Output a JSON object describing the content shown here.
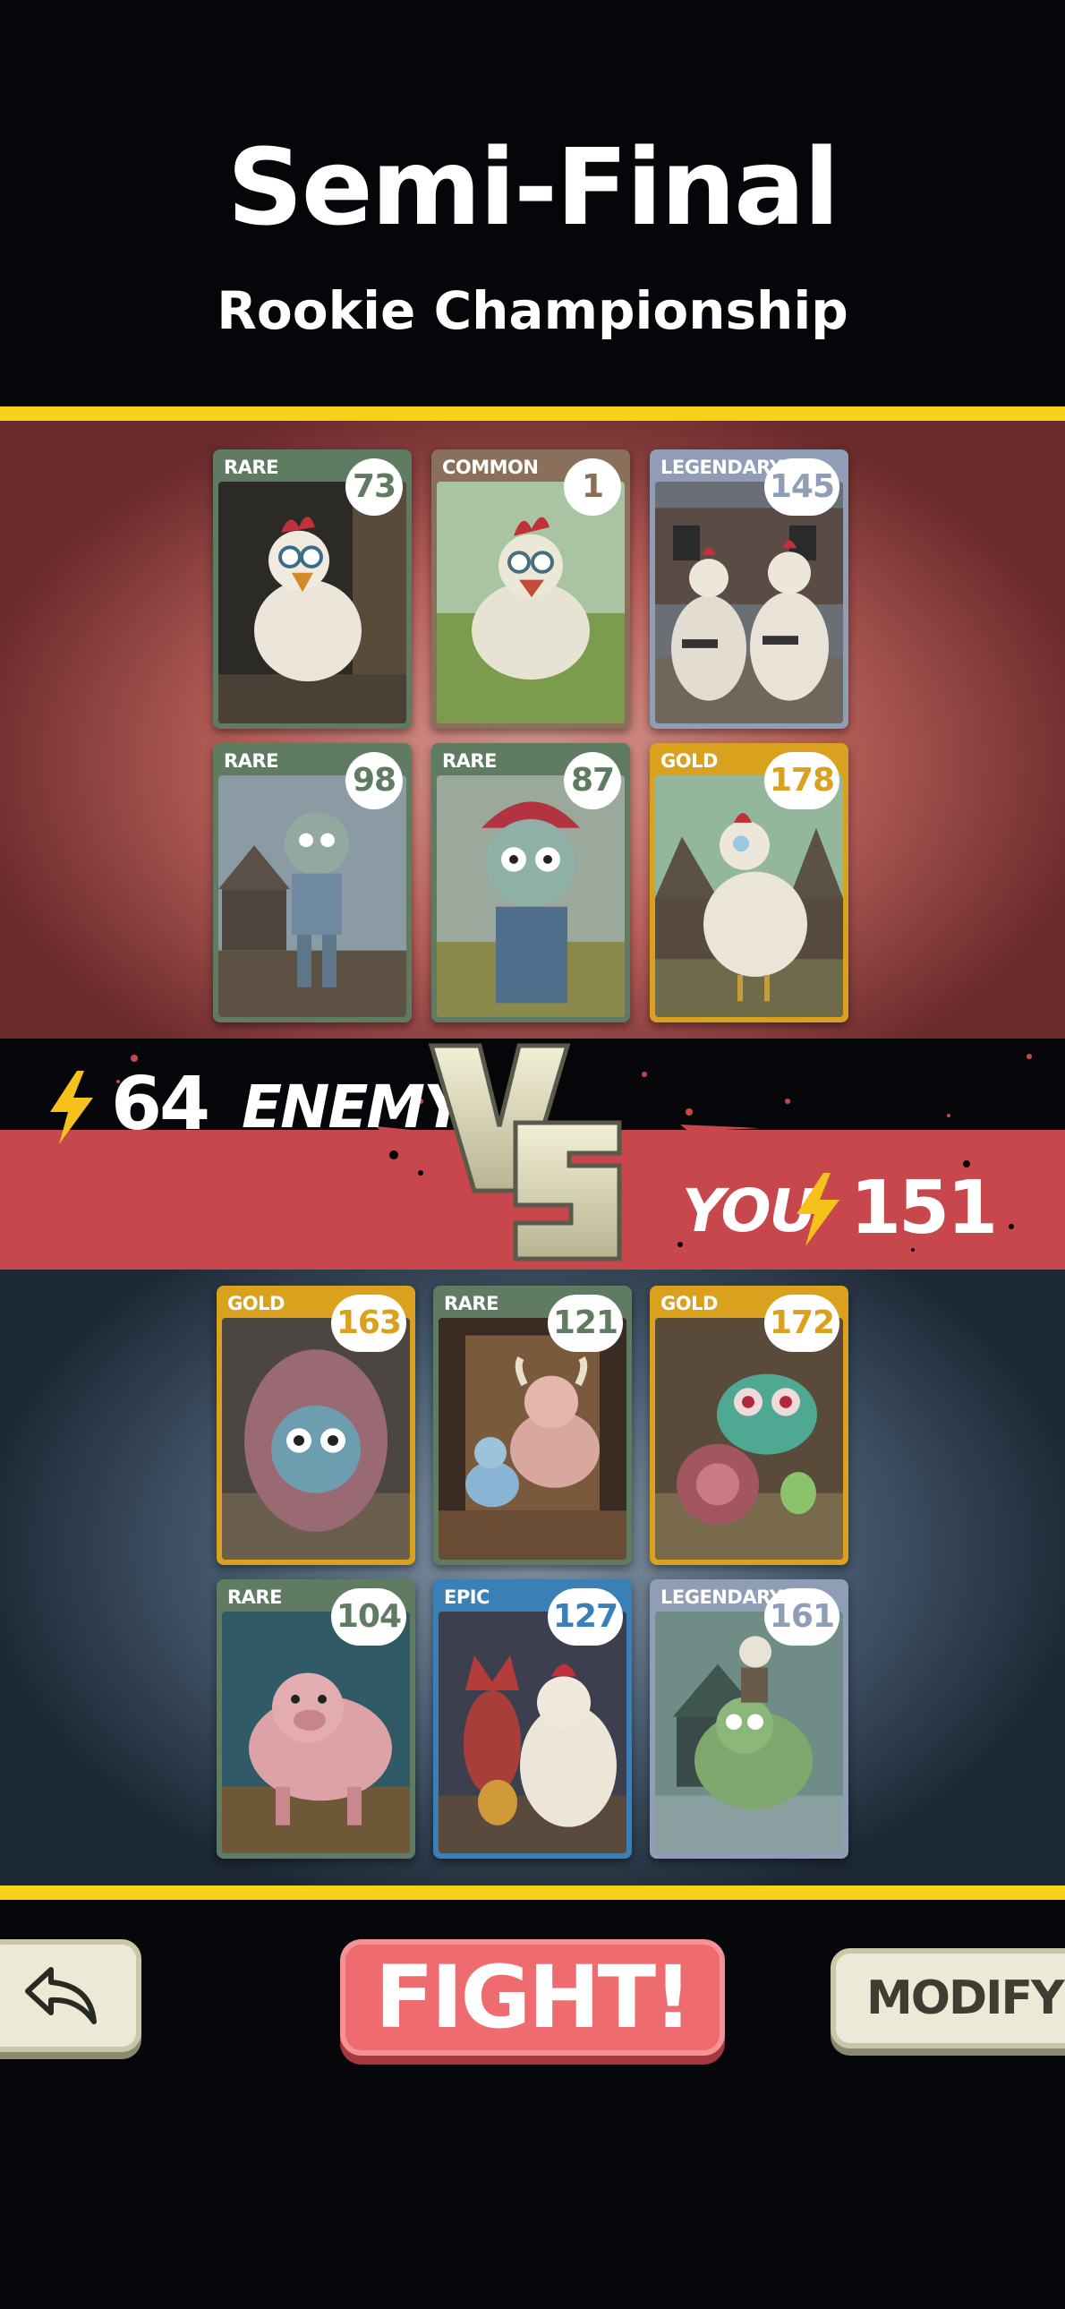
{
  "header": {
    "title": "Semi-Final",
    "subtitle": "Rookie Championship"
  },
  "enemy": {
    "label": "ENEMY",
    "power": "64",
    "cards": [
      {
        "rarity": "RARE",
        "power": "73",
        "subject": "startled white chicken in a barn"
      },
      {
        "rarity": "COMMON",
        "power": "1",
        "subject": "white chicken in a grassy field"
      },
      {
        "rarity": "LEGENDARY",
        "power": "145",
        "subject": "two armed chickens before a ruined house"
      },
      {
        "rarity": "RARE",
        "power": "98",
        "subject": "zombie farm boy by a barn"
      },
      {
        "rarity": "RARE",
        "power": "87",
        "subject": "red-haired zombie in overalls"
      },
      {
        "rarity": "GOLD",
        "power": "178",
        "subject": "white chicken by abandoned houses"
      }
    ]
  },
  "player": {
    "label": "YOU",
    "power": "151",
    "cards": [
      {
        "rarity": "GOLD",
        "power": "163",
        "subject": "zombie face hatching from an egg"
      },
      {
        "rarity": "RARE",
        "power": "121",
        "subject": "zombie cow and calf in a barn"
      },
      {
        "rarity": "GOLD",
        "power": "172",
        "subject": "green snail monster in a shed"
      },
      {
        "rarity": "RARE",
        "power": "104",
        "subject": "pink zombie pig"
      },
      {
        "rarity": "EPIC",
        "power": "127",
        "subject": "red fox and white chicken"
      },
      {
        "rarity": "LEGENDARY",
        "power": "161",
        "subject": "green zombie cow on a village road"
      }
    ]
  },
  "vs_text": "VS",
  "buttons": {
    "fight": "FIGHT!",
    "modify": "MODIFY",
    "back_icon": "undo-arrow-icon"
  },
  "colors": {
    "RARE": "#5f7c63",
    "COMMON": "#8a6f5b",
    "LEGENDARY": "#8f9db6",
    "GOLD": "#d9a11e",
    "EPIC": "#3a7fb6",
    "accent_yellow": "#f6d21a",
    "fight_red": "#ee6b70",
    "stripe_red": "#c8474d"
  }
}
